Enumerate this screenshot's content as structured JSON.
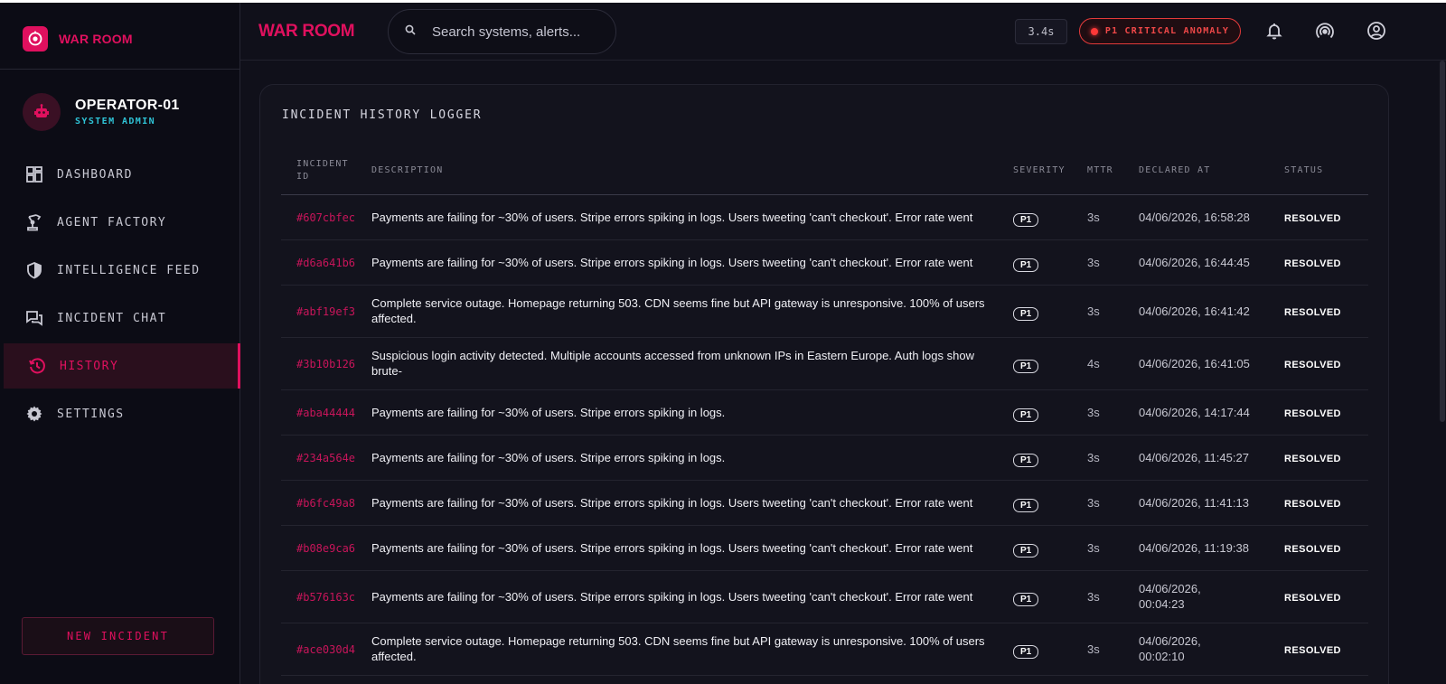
{
  "brand": {
    "name": "WAR ROOM"
  },
  "user": {
    "name": "OPERATOR-01",
    "role": "SYSTEM ADMIN"
  },
  "nav": [
    {
      "label": "DASHBOARD",
      "icon": "dashboard-icon"
    },
    {
      "label": "AGENT FACTORY",
      "icon": "robot-arm-icon"
    },
    {
      "label": "INTELLIGENCE FEED",
      "icon": "shield-icon"
    },
    {
      "label": "INCIDENT CHAT",
      "icon": "chat-icon"
    },
    {
      "label": "HISTORY",
      "icon": "history-icon",
      "active": true
    },
    {
      "label": "SETTINGS",
      "icon": "gear-icon"
    }
  ],
  "new_incident_label": "NEW INCIDENT",
  "header": {
    "title": "WAR ROOM",
    "search_placeholder": "Search systems, alerts...",
    "latency": "3.4s",
    "anomaly": "P1 CRITICAL ANOMALY"
  },
  "colors": {
    "accent": "#e0105e",
    "alert": "#f04848",
    "role": "#2fc3d6"
  },
  "card": {
    "title": "INCIDENT HISTORY LOGGER",
    "columns": {
      "id": "INCIDENT ID",
      "description": "DESCRIPTION",
      "severity": "SEVERITY",
      "mttr": "MTTR",
      "declared": "DECLARED AT",
      "status": "STATUS"
    },
    "rows": [
      {
        "id": "#607cbfec",
        "description": "Payments are failing for ~30% of users. Stripe errors spiking in logs. Users tweeting 'can't checkout'. Error rate went",
        "severity": "P1",
        "mttr": "3s",
        "declared": "04/06/2026, 16:58:28",
        "status": "RESOLVED"
      },
      {
        "id": "#d6a641b6",
        "description": "Payments are failing for ~30% of users. Stripe errors spiking in logs. Users tweeting 'can't checkout'. Error rate went",
        "severity": "P1",
        "mttr": "3s",
        "declared": "04/06/2026, 16:44:45",
        "status": "RESOLVED"
      },
      {
        "id": "#abf19ef3",
        "description": "Complete service outage. Homepage returning 503. CDN seems fine but API gateway is unresponsive. 100% of users affected.",
        "severity": "P1",
        "mttr": "3s",
        "declared": "04/06/2026, 16:41:42",
        "status": "RESOLVED"
      },
      {
        "id": "#3b10b126",
        "description": "Suspicious login activity detected. Multiple accounts accessed from unknown IPs in Eastern Europe. Auth logs show brute-",
        "severity": "P1",
        "mttr": "4s",
        "declared": "04/06/2026, 16:41:05",
        "status": "RESOLVED"
      },
      {
        "id": "#aba44444",
        "description": "Payments are failing for ~30% of users. Stripe errors spiking in logs.",
        "severity": "P1",
        "mttr": "3s",
        "declared": "04/06/2026, 14:17:44",
        "status": "RESOLVED"
      },
      {
        "id": "#234a564e",
        "description": "Payments are failing for ~30% of users. Stripe errors spiking in logs.",
        "severity": "P1",
        "mttr": "3s",
        "declared": "04/06/2026, 11:45:27",
        "status": "RESOLVED"
      },
      {
        "id": "#b6fc49a8",
        "description": "Payments are failing for ~30% of users. Stripe errors spiking in logs. Users tweeting 'can't checkout'. Error rate went",
        "severity": "P1",
        "mttr": "3s",
        "declared": "04/06/2026, 11:41:13",
        "status": "RESOLVED"
      },
      {
        "id": "#b08e9ca6",
        "description": "Payments are failing for ~30% of users. Stripe errors spiking in logs. Users tweeting 'can't checkout'. Error rate went",
        "severity": "P1",
        "mttr": "3s",
        "declared": "04/06/2026, 11:19:38",
        "status": "RESOLVED"
      },
      {
        "id": "#b576163c",
        "description": "Payments are failing for ~30% of users. Stripe errors spiking in logs. Users tweeting 'can't checkout'. Error rate went",
        "severity": "P1",
        "mttr": "3s",
        "declared": "04/06/2026, 00:04:23",
        "status": "RESOLVED"
      },
      {
        "id": "#ace030d4",
        "description": "Complete service outage. Homepage returning 503. CDN seems fine but API gateway is unresponsive. 100% of users affected.",
        "severity": "P1",
        "mttr": "3s",
        "declared": "04/06/2026, 00:02:10",
        "status": "RESOLVED"
      }
    ]
  }
}
